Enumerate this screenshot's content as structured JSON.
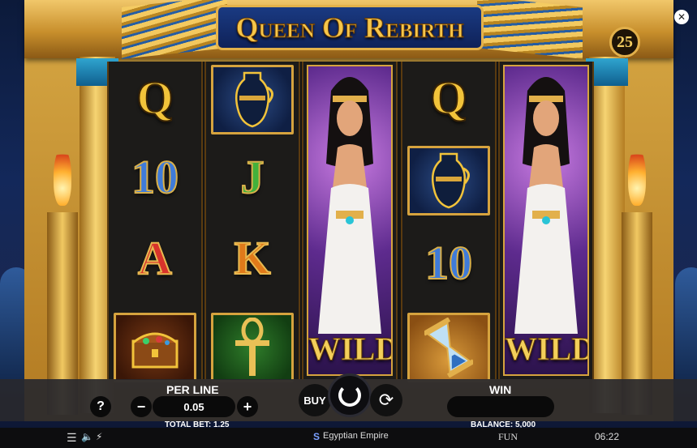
{
  "game": {
    "title": "Queen Of Rebirth",
    "lines": "25"
  },
  "reels": {
    "r1": [
      "Q",
      "10",
      "A",
      "chest"
    ],
    "r2": [
      "vase",
      "J",
      "K",
      "ankh"
    ],
    "r3": [
      "wild-queen"
    ],
    "r4": [
      "Q",
      "vase",
      "10",
      "hourglass"
    ],
    "r5": [
      "wild-queen"
    ],
    "wild_label": "WILD"
  },
  "controls": {
    "help_label": "?",
    "per_line_label": "PER LINE",
    "per_line_value": "0.05",
    "minus_label": "−",
    "plus_label": "+",
    "total_bet": "TOTAL BET: 1.25",
    "buy_label": "BUY",
    "win_label": "WIN",
    "win_value": "",
    "balance": "BALANCE: 5,000"
  },
  "bottom_bar": {
    "brand": "Egyptian Empire",
    "mode": "FUN",
    "time": "06:22"
  },
  "colors": {
    "gold": "#f2c33a",
    "panel": "#28282e",
    "sky": "#13285a"
  }
}
